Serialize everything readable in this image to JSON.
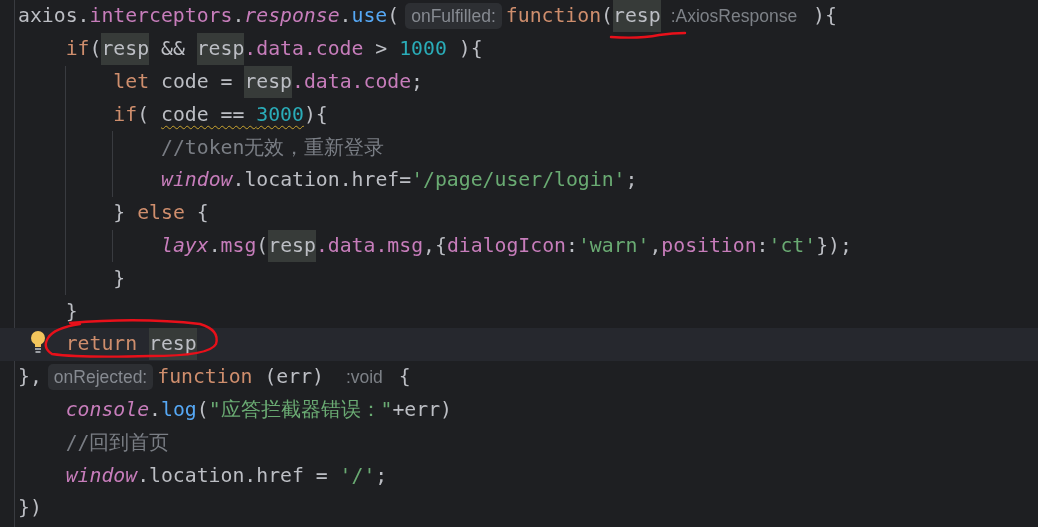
{
  "editor": {
    "lines": [
      {
        "current": false,
        "tokens": [
          {
            "kind": "plain",
            "text": "axios."
          },
          {
            "kind": "field",
            "text": "interceptors"
          },
          {
            "kind": "plain",
            "text": "."
          },
          {
            "kind": "static",
            "text": "response"
          },
          {
            "kind": "plain",
            "text": "."
          },
          {
            "kind": "method",
            "text": "use"
          },
          {
            "kind": "plain",
            "text": "("
          },
          {
            "kind": "param_hint",
            "text": "onFulfilled:"
          },
          {
            "kind": "keyword",
            "text": "function"
          },
          {
            "kind": "plain",
            "text": "("
          },
          {
            "kind": "occurrence",
            "text": "resp",
            "underlined": true
          },
          {
            "kind": "type_hint",
            "text": ":AxiosResponse"
          },
          {
            "kind": "plain",
            "text": " ){"
          }
        ],
        "children": [
          {
            "current": false,
            "tokens": [
              {
                "kind": "keyword",
                "text": "if"
              },
              {
                "kind": "plain",
                "text": "("
              },
              {
                "kind": "occurrence",
                "text": "resp"
              },
              {
                "kind": "plain",
                "text": " && "
              },
              {
                "kind": "occurrence",
                "text": "resp"
              },
              {
                "kind": "field",
                "text": ".data.code"
              },
              {
                "kind": "plain",
                "text": " > "
              },
              {
                "kind": "number",
                "text": "1000"
              },
              {
                "kind": "plain",
                "text": " ){"
              }
            ],
            "children": [
              {
                "current": false,
                "tokens": [
                  {
                    "kind": "keyword",
                    "text": "let "
                  },
                  {
                    "kind": "plain",
                    "text": "code = "
                  },
                  {
                    "kind": "occurrence",
                    "text": "resp"
                  },
                  {
                    "kind": "field",
                    "text": ".data.code"
                  },
                  {
                    "kind": "plain",
                    "text": ";"
                  }
                ]
              },
              {
                "current": false,
                "tokens": [
                  {
                    "kind": "keyword",
                    "text": "if"
                  },
                  {
                    "kind": "plain",
                    "text": "( "
                  },
                  {
                    "kind": "warned",
                    "parts": [
                      {
                        "kind": "plain",
                        "text": "code == "
                      },
                      {
                        "kind": "number",
                        "text": "3000"
                      }
                    ]
                  },
                  {
                    "kind": "plain",
                    "text": "){"
                  }
                ],
                "children": [
                  {
                    "current": false,
                    "tokens": [
                      {
                        "kind": "comment",
                        "text": "//token无效，重新登录"
                      }
                    ]
                  },
                  {
                    "current": false,
                    "tokens": [
                      {
                        "kind": "static",
                        "text": "window"
                      },
                      {
                        "kind": "plain",
                        "text": ".location.href="
                      },
                      {
                        "kind": "string",
                        "text": "'/page/user/login'"
                      },
                      {
                        "kind": "plain",
                        "text": ";"
                      }
                    ]
                  }
                ]
              },
              {
                "current": false,
                "tokens": [
                  {
                    "kind": "plain",
                    "text": "} "
                  },
                  {
                    "kind": "keyword",
                    "text": "else"
                  },
                  {
                    "kind": "plain",
                    "text": " {"
                  }
                ],
                "children": [
                  {
                    "current": false,
                    "tokens": [
                      {
                        "kind": "static",
                        "text": "layx"
                      },
                      {
                        "kind": "plain",
                        "text": "."
                      },
                      {
                        "kind": "field",
                        "text": "msg"
                      },
                      {
                        "kind": "plain",
                        "text": "("
                      },
                      {
                        "kind": "occurrence",
                        "text": "resp"
                      },
                      {
                        "kind": "field",
                        "text": ".data.msg"
                      },
                      {
                        "kind": "plain",
                        "text": ",{"
                      },
                      {
                        "kind": "field",
                        "text": "dialogIcon"
                      },
                      {
                        "kind": "plain",
                        "text": ":"
                      },
                      {
                        "kind": "string",
                        "text": "'warn'"
                      },
                      {
                        "kind": "plain",
                        "text": ","
                      },
                      {
                        "kind": "field",
                        "text": "position"
                      },
                      {
                        "kind": "plain",
                        "text": ":"
                      },
                      {
                        "kind": "string",
                        "text": "'ct'"
                      },
                      {
                        "kind": "plain",
                        "text": "});"
                      }
                    ]
                  }
                ]
              },
              {
                "current": false,
                "tokens": [
                  {
                    "kind": "plain",
                    "text": "}"
                  }
                ]
              }
            ]
          },
          {
            "current": false,
            "tokens": [
              {
                "kind": "plain",
                "text": "}"
              }
            ]
          },
          {
            "current": true,
            "lightbulb": true,
            "circled": true,
            "tokens": [
              {
                "kind": "keyword",
                "text": "return "
              },
              {
                "kind": "occurrence",
                "text": "resp"
              }
            ]
          }
        ]
      },
      {
        "current": false,
        "tokens": [
          {
            "kind": "plain",
            "text": "},"
          },
          {
            "kind": "param_hint",
            "text": "onRejected:"
          },
          {
            "kind": "keyword",
            "text": "function "
          },
          {
            "kind": "plain",
            "text": "(err) "
          },
          {
            "kind": "type_hint",
            "text": ":void"
          },
          {
            "kind": "plain",
            "text": " {"
          }
        ],
        "children": [
          {
            "current": false,
            "tokens": [
              {
                "kind": "static",
                "text": "console"
              },
              {
                "kind": "plain",
                "text": "."
              },
              {
                "kind": "method",
                "text": "log"
              },
              {
                "kind": "plain",
                "text": "("
              },
              {
                "kind": "string",
                "text": "\"应答拦截器错误：\""
              },
              {
                "kind": "plain",
                "text": "+err)"
              }
            ]
          },
          {
            "current": false,
            "tokens": [
              {
                "kind": "comment",
                "text": "//回到首页"
              }
            ]
          },
          {
            "current": false,
            "tokens": [
              {
                "kind": "static",
                "text": "window"
              },
              {
                "kind": "plain",
                "text": ".location.href = "
              },
              {
                "kind": "string",
                "text": "'/'"
              },
              {
                "kind": "plain",
                "text": ";"
              }
            ]
          }
        ]
      },
      {
        "current": false,
        "tokens": [
          {
            "kind": "plain",
            "text": "})"
          }
        ]
      }
    ]
  }
}
